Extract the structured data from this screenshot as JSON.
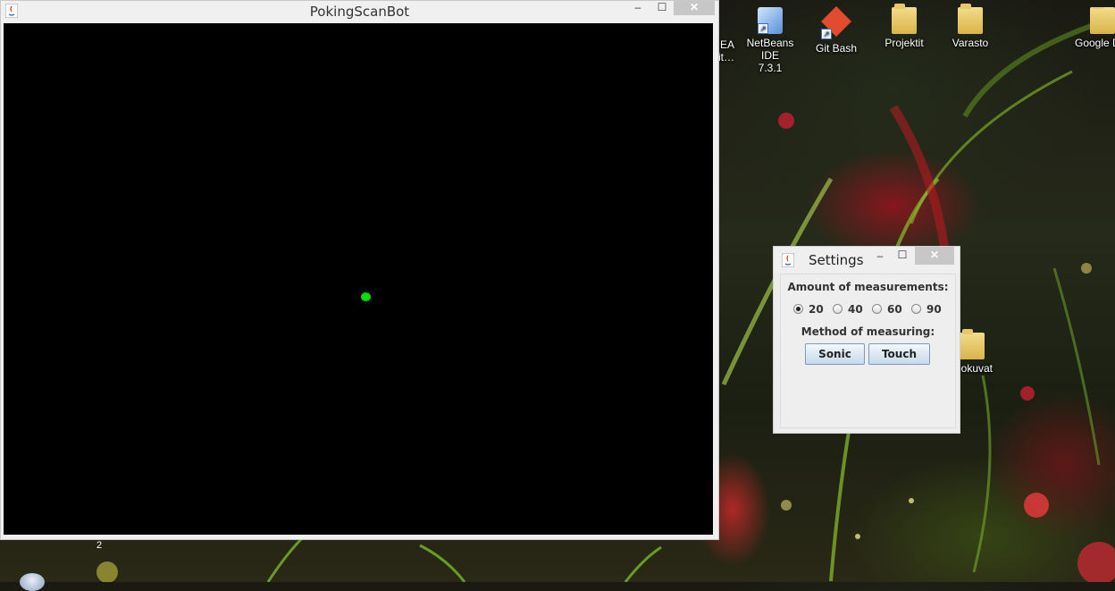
{
  "main_window": {
    "title": "PokingScanBot",
    "controls": {
      "minimize": "‒",
      "maximize": "☐",
      "close": "✕"
    },
    "canvas_color": "#000000",
    "dot_color": "#00dd00"
  },
  "settings_window": {
    "title": "Settings",
    "controls": {
      "minimize": "‒",
      "maximize": "☐",
      "close": "✕"
    },
    "measurements_label": "Amount of measurements:",
    "measurement_options": [
      "20",
      "40",
      "60",
      "90"
    ],
    "selected_measurement": "20",
    "method_label": "Method of measuring:",
    "sonic_button": "Sonic",
    "touch_button": "Touch"
  },
  "desktop_icons": [
    {
      "label": "EA",
      "label2": "it…",
      "icon": "app-shortcut-icon"
    },
    {
      "label": "NetBeans IDE",
      "label2": "7.3.1",
      "icon": "netbeans-icon"
    },
    {
      "label": "Git Bash",
      "label2": "",
      "icon": "git-bash-icon"
    },
    {
      "label": "Projektit",
      "label2": "",
      "icon": "folder-icon"
    },
    {
      "label": "Varasto",
      "label2": "",
      "icon": "folder-icon"
    },
    {
      "label": "Google D",
      "label2": "",
      "icon": "google-drive-folder-icon"
    },
    {
      "label": "ookuvat",
      "label2": "",
      "icon": "folder-icon"
    }
  ],
  "taskbar": {
    "badge": "2"
  }
}
